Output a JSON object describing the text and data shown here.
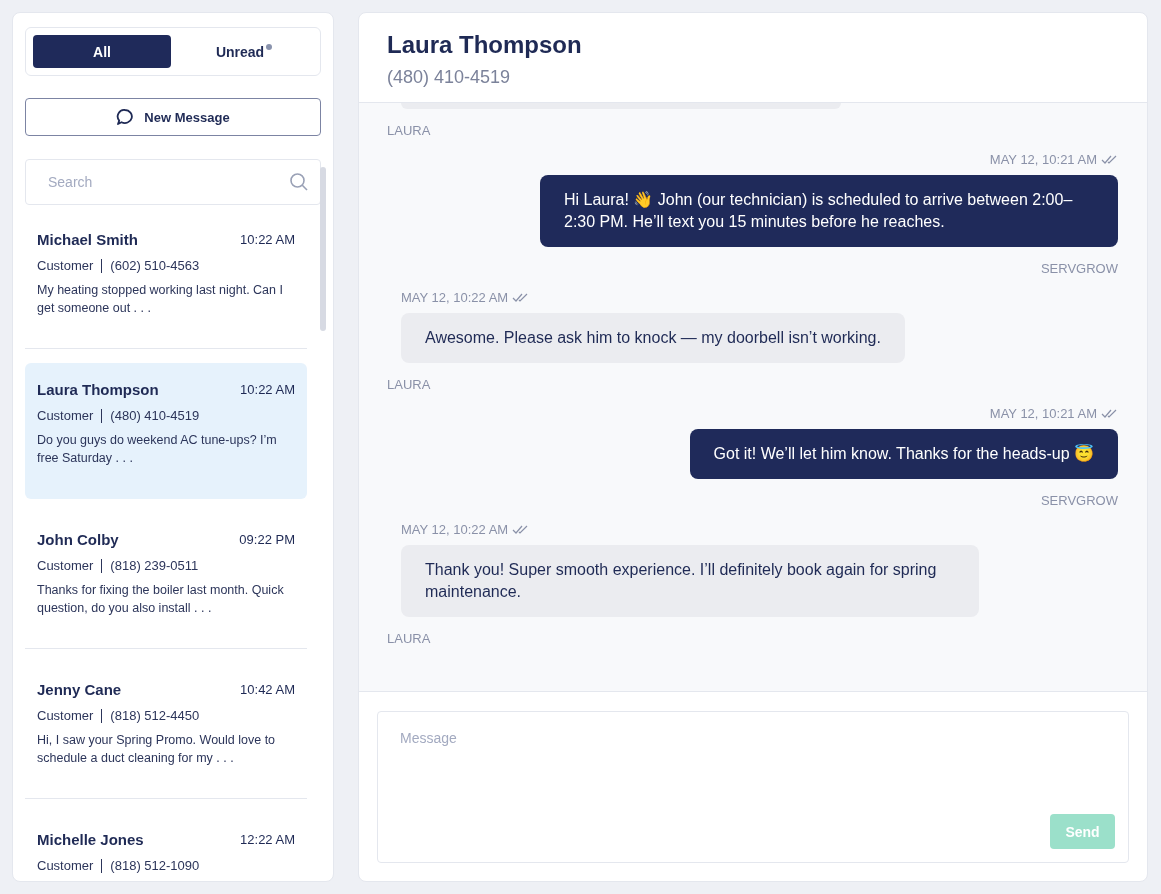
{
  "tabs": [
    {
      "label": "All",
      "selected": true,
      "indicator": false
    },
    {
      "label": "Unread",
      "selected": false,
      "indicator": true
    }
  ],
  "new_message_button": {
    "label": "New Message"
  },
  "search": {
    "placeholder": "Search"
  },
  "conversations": [
    {
      "name": "Michael Smith",
      "time": "10:22 AM",
      "role": "Customer",
      "phone": "(602) 510-4563",
      "preview": "My heating stopped working last night. Can I get someone out . . .",
      "selected": false
    },
    {
      "name": "Laura Thompson",
      "time": "10:22 AM",
      "role": "Customer",
      "phone": "(480) 410-4519",
      "preview": "Do you guys do weekend AC tune-ups? I’m free Saturday  . . .",
      "selected": true
    },
    {
      "name": "John Colby",
      "time": "09:22 PM",
      "role": "Customer",
      "phone": "(818) 239-0511",
      "preview": "Thanks for fixing the boiler last month. Quick question, do you also install . . .",
      "selected": false
    },
    {
      "name": "Jenny Cane",
      "time": "10:42 AM",
      "role": "Customer",
      "phone": "(818) 512-4450",
      "preview": "Hi, I saw your Spring Promo. Would love to schedule a duct cleaning for my . . .",
      "selected": false
    },
    {
      "name": "Michelle Jones",
      "time": "12:22 AM",
      "role": "Customer",
      "phone": "(818) 512-1090",
      "selected": false
    }
  ],
  "chat": {
    "contact_name": "Laura Thompson",
    "contact_phone": "(480) 410-4519",
    "messages": [
      {
        "kind": "incoming",
        "sender": "LAURA"
      },
      {
        "kind": "outgoing",
        "time": "MAY 12, 10:21 AM",
        "text": "Hi Laura! 👋 John (our technician) is scheduled to arrive between 2:00–2:30 PM. He’ll text you 15 minutes before he reaches.",
        "sender": "SERVGROW"
      },
      {
        "kind": "incoming",
        "time": "MAY 12, 10:22 AM",
        "text": "Awesome. Please ask him to knock — my doorbell isn’t working.",
        "sender": "LAURA"
      },
      {
        "kind": "outgoing",
        "time": "MAY 12, 10:21 AM",
        "text": "Got it! We’ll let him know. Thanks for the heads-up 😇",
        "sender": "SERVGROW"
      },
      {
        "kind": "incoming",
        "time": "MAY 12, 10:22 AM",
        "text": "Thank you! Super smooth experience. I’ll definitely book again for spring maintenance.",
        "sender": "LAURA"
      }
    ]
  },
  "composer": {
    "placeholder": "Message",
    "send_label": "Send",
    "send_disabled": true
  }
}
